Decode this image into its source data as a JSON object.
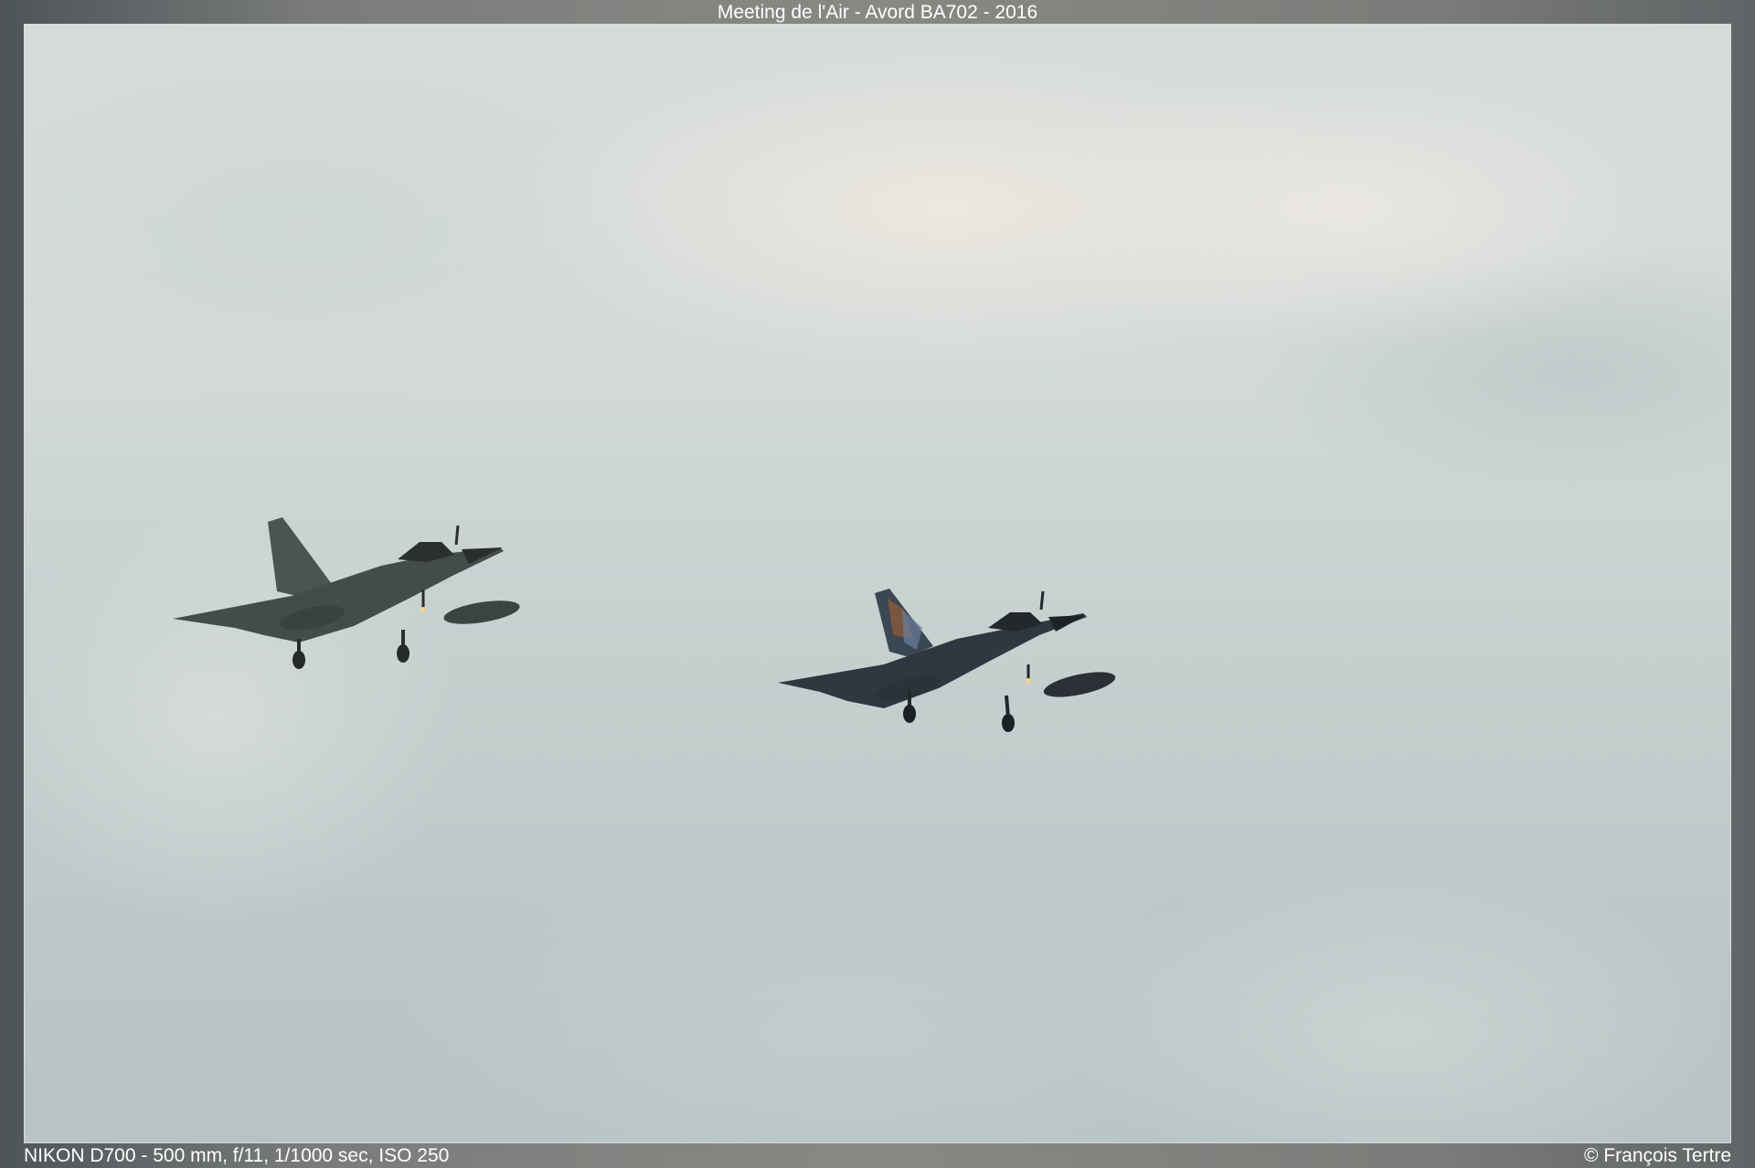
{
  "title": "Meeting de l'Air - Avord BA702 - 2016",
  "exif": "NIKON D700 - 500 mm, f/11, 1/1000 sec, ISO 250",
  "copyright": "© François Tertre",
  "colors": {
    "sky": "#c9d2d1",
    "aircraft": "#2f3432",
    "frame": "#7d7e7c",
    "border": "#d9dcdc"
  }
}
